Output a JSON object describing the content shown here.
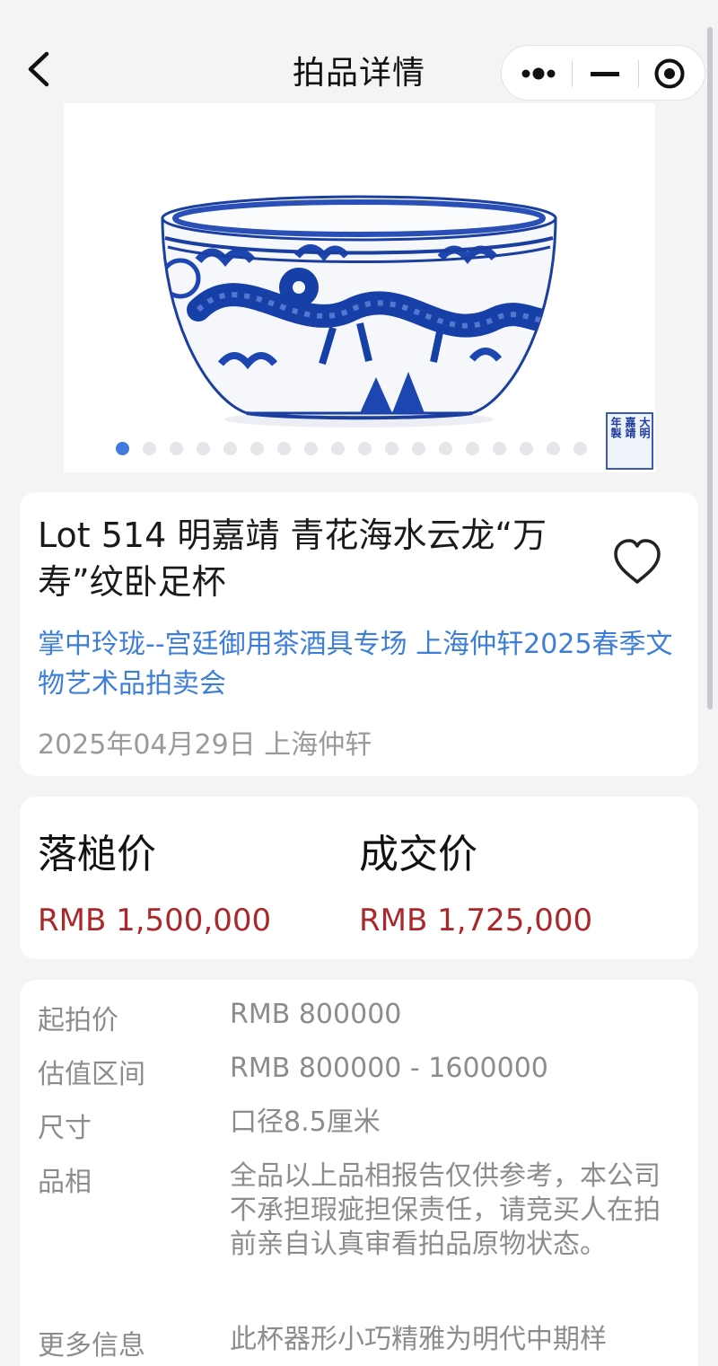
{
  "header": {
    "title": "拍品详情"
  },
  "carousel": {
    "slide_count": 18,
    "active_index": 0,
    "seal_lines": [
      "大明",
      "嘉靖",
      "年製"
    ]
  },
  "lot": {
    "title": "Lot 514 明嘉靖 青花海水云龙“万寿”纹卧足杯",
    "auction": "掌中玲珑--宫廷御用茶酒具专场 上海仲轩2025春季文物艺术品拍卖会",
    "date_location": "2025年04月29日 上海仲轩",
    "favorited": false
  },
  "prices": {
    "hammer_label": "落槌价",
    "hammer_value": "RMB 1,500,000",
    "deal_label": "成交价",
    "deal_value": "RMB 1,725,000",
    "value_color": "#a8282c"
  },
  "details": [
    {
      "label": "起拍价",
      "value": "RMB 800000"
    },
    {
      "label": "估值区间",
      "value": "RMB 800000 - 1600000"
    },
    {
      "label": "尺寸",
      "value": "口径8.5厘米"
    },
    {
      "label": "品相",
      "value": "全品以上品相报告仅供参考，本公司不承担瑕疵担保责任，请竞买人在拍前亲自认真审看拍品原物状态。"
    },
    {
      "label": "更多信息",
      "value": "此杯器形小巧精雅为明代中期样"
    }
  ],
  "icons": {
    "back": "chevron-left-icon",
    "more": "more-dots-icon",
    "minimize": "minus-icon",
    "close": "target-circle-icon",
    "favorite": "heart-icon"
  },
  "colors": {
    "link": "#3d7ed9",
    "price": "#a8282c",
    "muted": "#8c8c8c",
    "accent_dot": "#3e7bdc"
  }
}
